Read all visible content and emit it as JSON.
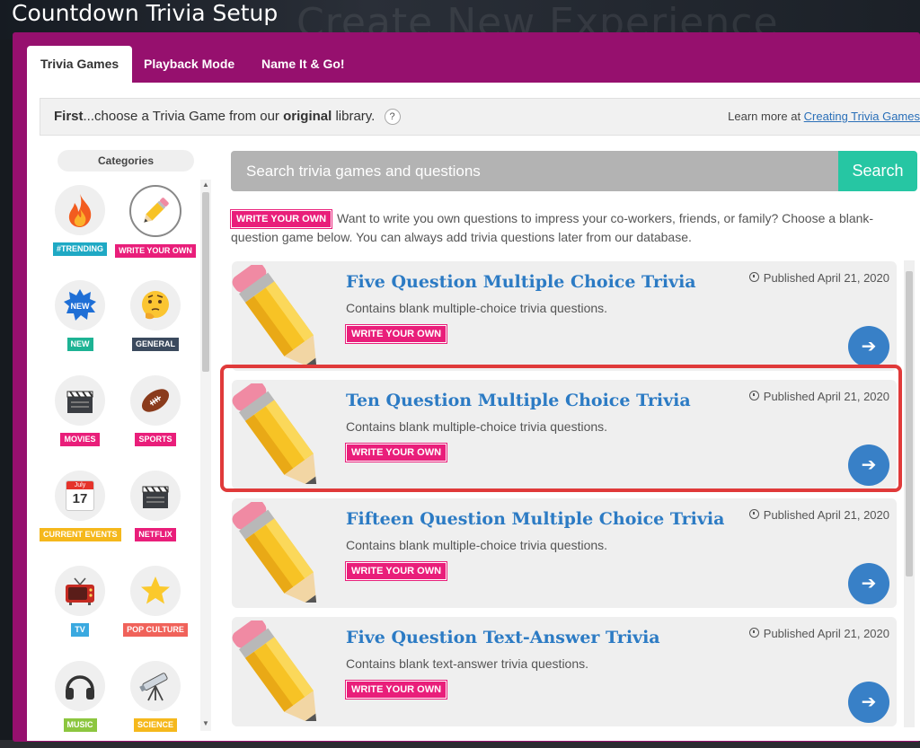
{
  "app_title": "Countdown Trivia Setup",
  "background_ghost_text": "Create New Experience",
  "tabs": [
    {
      "label": "Trivia Games",
      "active": true
    },
    {
      "label": "Playback Mode",
      "active": false
    },
    {
      "label": "Name It & Go!",
      "active": false
    }
  ],
  "topbar": {
    "first": "First",
    "text_a": "...choose a Trivia Game from our ",
    "bold": "original",
    "text_b": " library.",
    "help": "?",
    "learn_prefix": "Learn more at ",
    "learn_link": "Creating Trivia Games"
  },
  "categories_label": "Categories",
  "categories": [
    {
      "label": "#TRENDING",
      "icon": "fire-icon",
      "color": "#1fa9c4"
    },
    {
      "label": "WRITE YOUR OWN",
      "icon": "pencil-icon",
      "color": "#e91e7a"
    },
    {
      "label": "NEW",
      "icon": "new-burst-icon",
      "color": "#1db394"
    },
    {
      "label": "GENERAL",
      "icon": "thinking-face-icon",
      "color": "#3b4a5e"
    },
    {
      "label": "MOVIES",
      "icon": "clapperboard-icon",
      "color": "#e91e7a"
    },
    {
      "label": "SPORTS",
      "icon": "football-icon",
      "color": "#e91e7a"
    },
    {
      "label": "CURRENT EVENTS",
      "icon": "calendar-icon",
      "color": "#f5b81c",
      "calendar_month": "July",
      "calendar_day": "17"
    },
    {
      "label": "NETFLIX",
      "icon": "clapperboard-icon",
      "color": "#e91e7a"
    },
    {
      "label": "TV",
      "icon": "tv-icon",
      "color": "#3aa9e0"
    },
    {
      "label": "POP CULTURE",
      "icon": "star-icon",
      "color": "#f0625a"
    },
    {
      "label": "MUSIC",
      "icon": "headphones-icon",
      "color": "#8cc63f"
    },
    {
      "label": "SCIENCE",
      "icon": "telescope-icon",
      "color": "#f5b81c"
    }
  ],
  "search": {
    "placeholder": "Search trivia games and questions",
    "button": "Search"
  },
  "intro": {
    "badge": "WRITE YOUR OWN",
    "text": "Want to write you own questions to impress your co-workers, friends, or family? Choose a blank-question game below. You can always add trivia questions later from our database."
  },
  "games": [
    {
      "title": "Five Question Multiple Choice Trivia",
      "desc": "Contains blank multiple-choice trivia questions.",
      "badge": "WRITE YOUR OWN",
      "date": "Published April 21, 2020",
      "highlighted": false
    },
    {
      "title": "Ten Question Multiple Choice Trivia",
      "desc": "Contains blank multiple-choice trivia questions.",
      "badge": "WRITE YOUR OWN",
      "date": "Published April 21, 2020",
      "highlighted": true
    },
    {
      "title": "Fifteen Question Multiple Choice Trivia",
      "desc": "Contains blank multiple-choice trivia questions.",
      "badge": "WRITE YOUR OWN",
      "date": "Published April 21, 2020",
      "highlighted": false
    },
    {
      "title": "Five Question Text-Answer Trivia",
      "desc": "Contains blank text-answer trivia questions.",
      "badge": "WRITE YOUR OWN",
      "date": "Published April 21, 2020",
      "highlighted": false
    }
  ],
  "colors": {
    "modal": "#96106e",
    "accent_pink": "#e91e7a",
    "search_button": "#26c6a3",
    "title_blue": "#2c7bc4",
    "go_button": "#3880c7",
    "highlight": "#e03a3a"
  }
}
